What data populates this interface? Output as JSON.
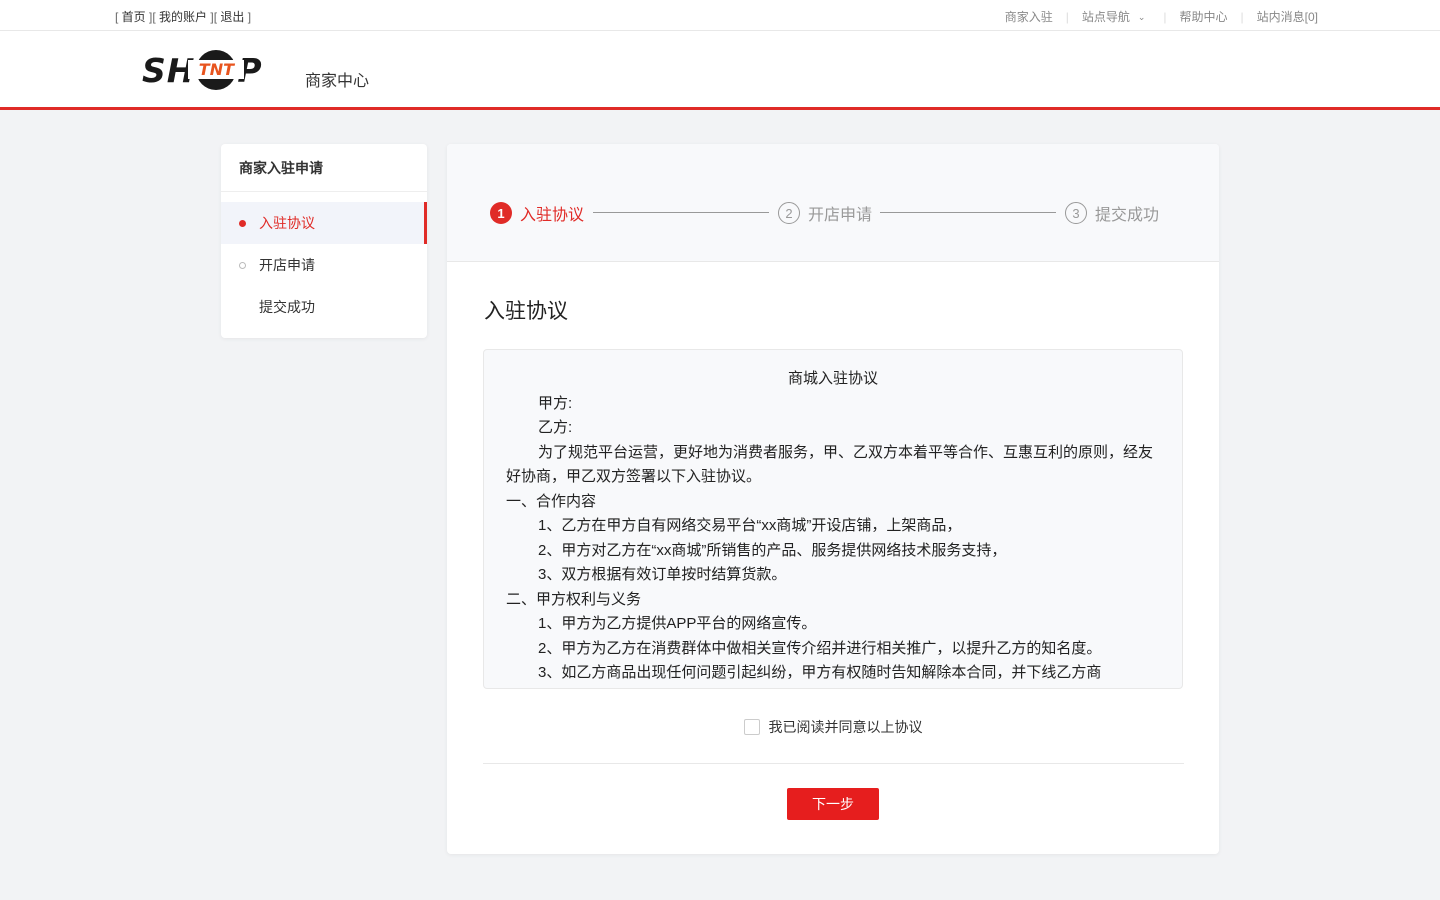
{
  "topbar": {
    "links_left": {
      "home": "首页",
      "account": "我的账户",
      "logout": "退出"
    },
    "right": {
      "merchant_join": "商家入驻",
      "site_nav": "站点导航",
      "help": "帮助中心",
      "messages": "站内消息[0]"
    }
  },
  "header": {
    "logo_left": "SH",
    "logo_band": "TNT",
    "logo_right": "P",
    "title": "商家中心"
  },
  "sidebar": {
    "title": "商家入驻申请",
    "items": [
      {
        "label": "入驻协议",
        "state": "active"
      },
      {
        "label": "开店申请",
        "state": "pending"
      },
      {
        "label": "提交成功",
        "state": "none"
      }
    ]
  },
  "steps": [
    {
      "num": "1",
      "label": "入驻协议"
    },
    {
      "num": "2",
      "label": "开店申请"
    },
    {
      "num": "3",
      "label": "提交成功"
    }
  ],
  "section_title": "入驻协议",
  "agreement": {
    "title": "商城入驻协议",
    "party_a": "甲方:",
    "party_b": "乙方:",
    "intro": "为了规范平台运营，更好地为消费者服务，甲、乙双方本着平等合作、互惠互利的原则，经友好协商，甲乙双方签署以下入驻协议。",
    "sec1": "一、合作内容",
    "sec1_items": [
      "1、乙方在甲方自有网络交易平台“xx商城”开设店铺，上架商品，",
      "2、甲方对乙方在“xx商城”所销售的产品、服务提供网络技术服务支持，",
      "3、双方根据有效订单按时结算货款。"
    ],
    "sec2": "二、甲方权利与义务",
    "sec2_items": [
      "1、甲方为乙方提供APP平台的网络宣传。",
      "2、甲方为乙方在消费群体中做相关宣传介绍并进行相关推广，以提升乙方的知名度。",
      "3、如乙方商品出现任何问题引起纠纷，甲方有权随时告知解除本合同，并下线乙方商"
    ]
  },
  "agree_label": "我已阅读并同意以上协议",
  "next_button": "下一步",
  "colors": {
    "accent": "#e02b27",
    "button": "#e61e1e",
    "page_bg": "#f2f3f5"
  }
}
